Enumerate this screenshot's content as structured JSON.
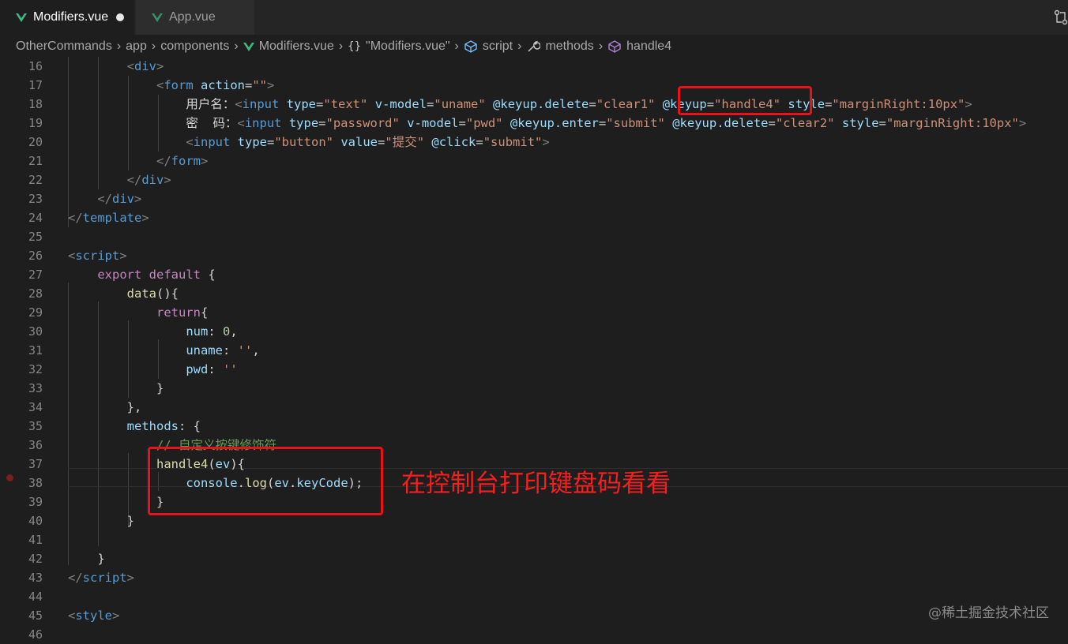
{
  "tabs": [
    {
      "label": "Modifiers.vue",
      "active": true,
      "unsaved": true
    },
    {
      "label": "App.vue",
      "active": false,
      "unsaved": false
    }
  ],
  "breadcrumb": {
    "items": [
      "OtherCommands",
      "app",
      "components",
      "Modifiers.vue",
      "\"Modifiers.vue\"",
      "script",
      "methods",
      "handle4"
    ]
  },
  "editor": {
    "lines": [
      {
        "num": "16"
      },
      {
        "num": "17"
      },
      {
        "num": "18"
      },
      {
        "num": "19"
      },
      {
        "num": "20"
      },
      {
        "num": "21"
      },
      {
        "num": "22"
      },
      {
        "num": "23"
      },
      {
        "num": "24"
      },
      {
        "num": "25"
      },
      {
        "num": "26"
      },
      {
        "num": "27"
      },
      {
        "num": "28"
      },
      {
        "num": "29"
      },
      {
        "num": "30"
      },
      {
        "num": "31"
      },
      {
        "num": "32"
      },
      {
        "num": "33"
      },
      {
        "num": "34"
      },
      {
        "num": "35"
      },
      {
        "num": "36"
      },
      {
        "num": "37"
      },
      {
        "num": "38"
      },
      {
        "num": "39"
      },
      {
        "num": "40"
      },
      {
        "num": "41"
      },
      {
        "num": "42"
      },
      {
        "num": "43"
      },
      {
        "num": "44"
      },
      {
        "num": "45"
      },
      {
        "num": "46"
      }
    ]
  },
  "annotation": "在控制台打印键盘码看看",
  "watermark": "@稀土掘金技术社区",
  "colors": {
    "annotation_red": "#e8131a",
    "vue_green": "#41b883",
    "editor_bg": "#1e1e1e"
  }
}
